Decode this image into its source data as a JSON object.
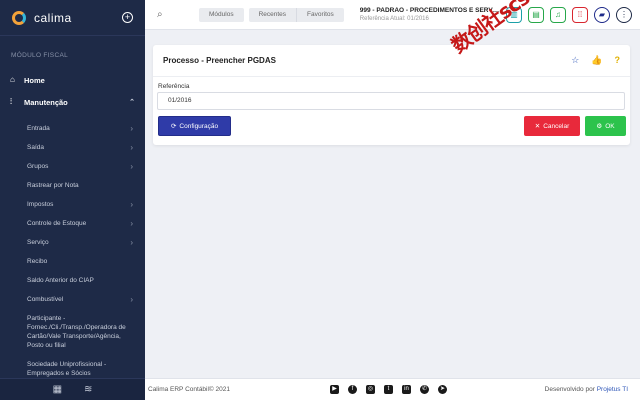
{
  "sidebar": {
    "brand": "calima",
    "section": "MÓDULO FISCAL",
    "home": "Home",
    "manutencao": "Manutenção",
    "items": [
      {
        "label": "Entrada",
        "arrow": true
      },
      {
        "label": "Saída",
        "arrow": true
      },
      {
        "label": "Grupos",
        "arrow": true
      },
      {
        "label": "Rastrear por Nota",
        "arrow": false
      },
      {
        "label": "Impostos",
        "arrow": true
      },
      {
        "label": "Controle de Estoque",
        "arrow": true
      },
      {
        "label": "Serviço",
        "arrow": true
      },
      {
        "label": "Recibo",
        "arrow": false
      },
      {
        "label": "Saldo Anterior do CIAP",
        "arrow": false
      },
      {
        "label": "Combustível",
        "arrow": true
      },
      {
        "label": "Participante - Fornec./Cli./Transp./Operadora de Cartão/Vale Transporte/Agência, Posto ou filial",
        "arrow": false
      },
      {
        "label": "Sociedade Uniprofissional - Empregados e Sócios",
        "arrow": false
      }
    ]
  },
  "header": {
    "tab_modulos": "Módulos",
    "tab_recentes": "Recentes",
    "tab_favoritos": "Favoritos",
    "company": "999 - PADRAO - PROCEDIMENTOS E SERVIÇOS",
    "reference": "Referência Atual: 01/2016"
  },
  "colors": {
    "sidebar_bg": "#1e2a47",
    "primary": "#2f3ba8",
    "danger": "#e8293b",
    "success": "#2cc34c",
    "icon_teal": "#1ba0a8",
    "icon_green": "#27a74a",
    "icon_red": "#d8262f",
    "icon_navy": "#1e2a8a"
  },
  "card": {
    "title": "Processo - Preencher PGDAS",
    "field_label": "Referência",
    "field_value": "01/2016",
    "btn_config": "Configuração",
    "btn_cancel": "Cancelar",
    "btn_ok": "OK"
  },
  "watermark": "数创社scs66",
  "footer": {
    "left": "Calima ERP Contábil© 2021",
    "right_prefix": "Desenvolvido por",
    "right_brand": "Projetus TI"
  }
}
